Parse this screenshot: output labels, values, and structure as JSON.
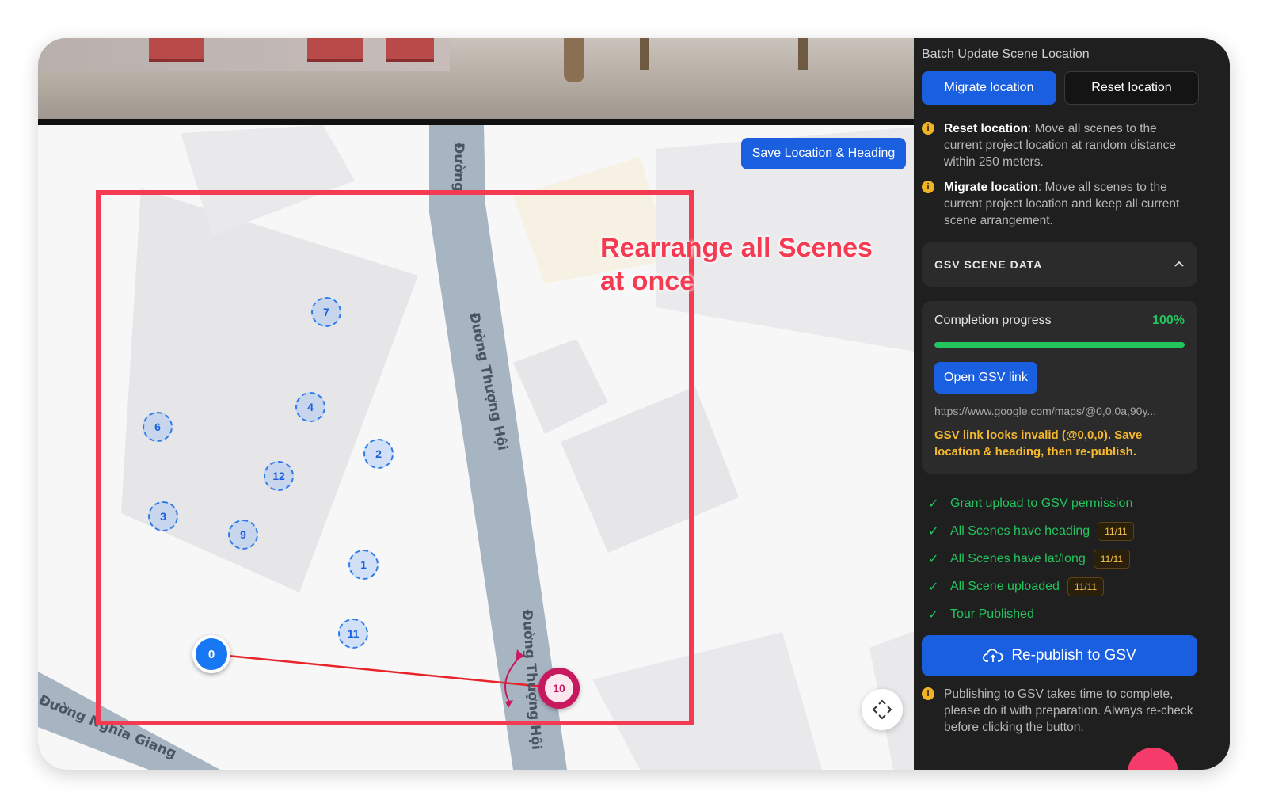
{
  "map": {
    "save_button": "Save Location & Heading",
    "street_top": "Đường",
    "street_main": "Đường Thượng Hội",
    "street_lower": "Đường Thượng Hội",
    "street_bottom_left": "Đường Nghĩa Giang",
    "annotation": "Rearrange all Scenes at once",
    "markers": [
      "7",
      "4",
      "6",
      "2",
      "12",
      "3",
      "9",
      "1",
      "11"
    ],
    "marker_start": "0",
    "marker_active": "10",
    "recenter_icon": "recenter-icon"
  },
  "panel": {
    "title": "Batch Update Scene Location",
    "migrate_button": "Migrate location",
    "reset_button": "Reset location",
    "info_reset_title": "Reset location",
    "info_reset_text": ": Move all scenes to the current project location at random distance within 250 meters.",
    "info_migrate_title": "Migrate location",
    "info_migrate_text": ": Move all scenes to the current project location and keep all current scene arrangement.",
    "section_title": "GSV SCENE DATA",
    "progress_label": "Completion progress",
    "progress_value": "100%",
    "progress_fraction": 1.0,
    "open_gsv_button": "Open GSV link",
    "gsv_url": "https://www.google.com/maps/@0,0,0a,90y...",
    "gsv_warning": "GSV link looks invalid (@0,0,0). Save location & heading, then re-publish.",
    "checks": [
      {
        "label": "Grant upload to GSV permission",
        "badge": ""
      },
      {
        "label": "All Scenes have heading",
        "badge": "11/11"
      },
      {
        "label": "All Scenes have lat/long",
        "badge": "11/11"
      },
      {
        "label": "All Scene uploaded",
        "badge": "11/11"
      },
      {
        "label": "Tour Published",
        "badge": ""
      }
    ],
    "republish_button": "Re-publish to GSV",
    "publish_note": "Publishing to GSV takes time to complete, please do it with preparation. Always re-check before clicking the button.",
    "colors": {
      "accent": "#1a5fe0",
      "success": "#22c55e",
      "warning": "#f5b82e",
      "highlight": "#f43b52"
    }
  }
}
